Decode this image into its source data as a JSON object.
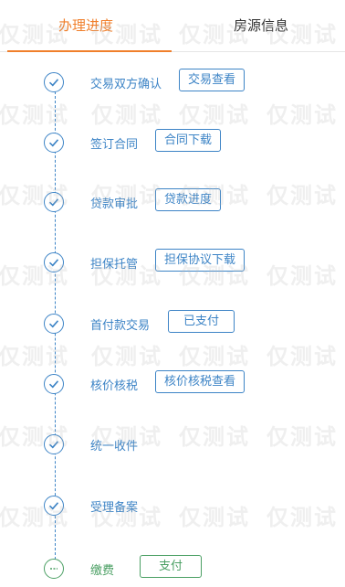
{
  "tabs": [
    {
      "label": "办理进度",
      "active": true
    },
    {
      "label": "房源信息",
      "active": false
    }
  ],
  "colors": {
    "accent": "#f07f2b",
    "step_blue": "#3d84c6",
    "step_green": "#4a9f63"
  },
  "steps": [
    {
      "label": "交易双方确认",
      "button": "交易查看",
      "state": "done"
    },
    {
      "label": "签订合同",
      "button": "合同下载",
      "state": "done"
    },
    {
      "label": "贷款审批",
      "button": "贷款进度",
      "state": "done"
    },
    {
      "label": "担保托管",
      "button": "担保协议下载",
      "state": "done"
    },
    {
      "label": "首付款交易",
      "button": "已支付",
      "state": "done"
    },
    {
      "label": "核价核税",
      "button": "核价核税查看",
      "state": "done"
    },
    {
      "label": "统一收件",
      "state": "done"
    },
    {
      "label": "受理备案",
      "state": "done"
    },
    {
      "label": "缴费",
      "button": "支付",
      "state": "current"
    }
  ],
  "watermark": "仅测试"
}
